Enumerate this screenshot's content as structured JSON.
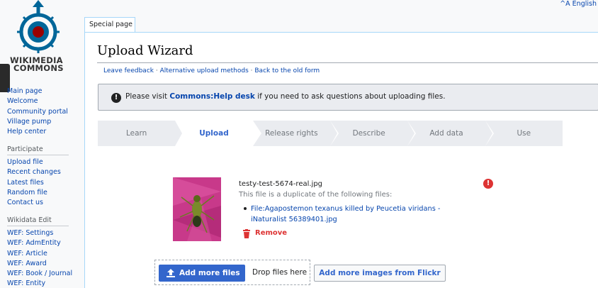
{
  "header": {
    "language_link": "^A English"
  },
  "logo": {
    "line1": "WIKIMEDIA",
    "line2": "COMMONS"
  },
  "sidebar": {
    "main_items": [
      {
        "label": "Main page"
      },
      {
        "label": "Welcome"
      },
      {
        "label": "Community portal"
      },
      {
        "label": "Village pump"
      },
      {
        "label": "Help center"
      }
    ],
    "participate_heading": "Participate",
    "participate_items": [
      {
        "label": "Upload file"
      },
      {
        "label": "Recent changes"
      },
      {
        "label": "Latest files"
      },
      {
        "label": "Random file"
      },
      {
        "label": "Contact us"
      }
    ],
    "wikidata_heading": "Wikidata Edit",
    "wikidata_items": [
      {
        "label": "WEF: Settings"
      },
      {
        "label": "WEF: AdmEntity"
      },
      {
        "label": "WEF: Article"
      },
      {
        "label": "WEF: Award"
      },
      {
        "label": "WEF: Book / Journal"
      },
      {
        "label": "WEF: Entity"
      }
    ]
  },
  "page_tab": {
    "label": "Special page"
  },
  "page": {
    "title": "Upload Wizard",
    "links": {
      "feedback": "Leave feedback",
      "alternative": "Alternative upload methods",
      "old_form": "Back to the old form",
      "separator": " · "
    }
  },
  "notice": {
    "prefix": "Please visit ",
    "link": "Commons:Help desk",
    "suffix": " if you need to ask questions about uploading files."
  },
  "steps": [
    {
      "label": "Learn",
      "active": false
    },
    {
      "label": "Upload",
      "active": true
    },
    {
      "label": "Release rights",
      "active": false
    },
    {
      "label": "Describe",
      "active": false
    },
    {
      "label": "Add data",
      "active": false
    },
    {
      "label": "Use",
      "active": false
    }
  ],
  "upload_item": {
    "file_name": "testy-test-5674-real.jpg",
    "duplicate_message": "This file is a duplicate of the following files:",
    "duplicate_link_line1": "File:Agapostemon texanus killed by Peucetia viridans -",
    "duplicate_link_line2": "iNaturalist 56389401.jpg",
    "remove_label": "Remove"
  },
  "actions": {
    "add_more_files": "Add more files",
    "drop_files_here": "Drop files here",
    "add_from_flickr": "Add more images from Flickr"
  },
  "colors": {
    "link": "#0645ad",
    "accent": "#3366cc",
    "error": "#dd3333"
  }
}
